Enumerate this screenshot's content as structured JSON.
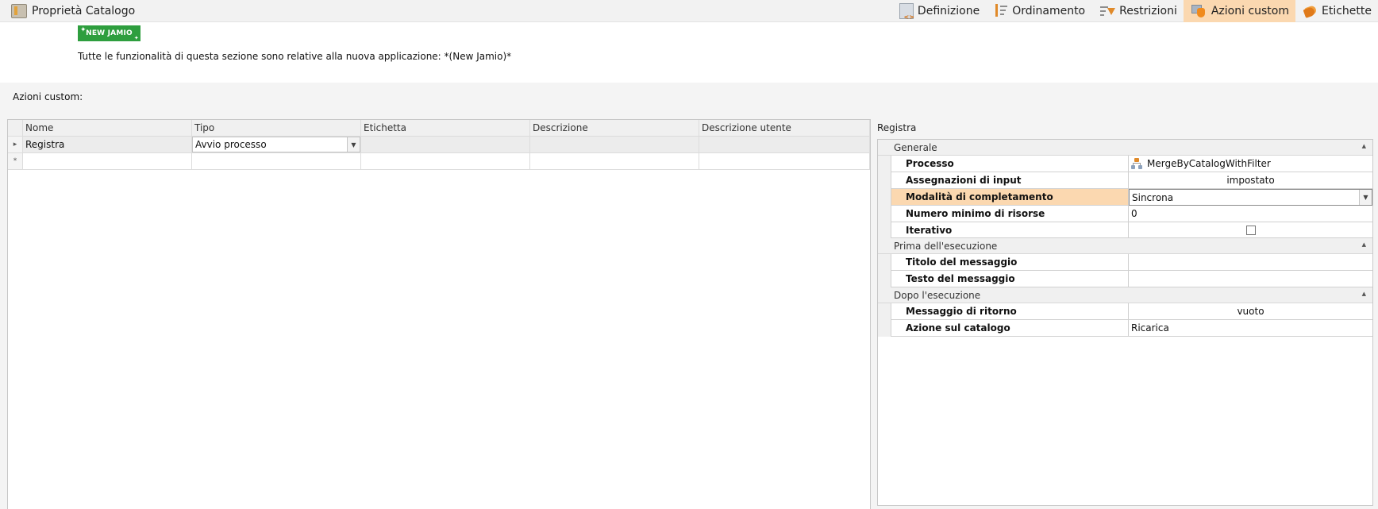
{
  "window": {
    "title": "Proprietà Catalogo"
  },
  "tabs": [
    {
      "label": "Definizione",
      "icon": "definition-icon",
      "active": false
    },
    {
      "label": "Ordinamento",
      "icon": "sort-icon",
      "active": false
    },
    {
      "label": "Restrizioni",
      "icon": "filter-icon",
      "active": false
    },
    {
      "label": "Azioni custom",
      "icon": "custom-action-icon",
      "active": true
    },
    {
      "label": "Etichette",
      "icon": "tag-icon",
      "active": false
    }
  ],
  "info": {
    "badge": "NEW JAMIO",
    "text": "Tutte le funzionalità di questa sezione sono relative alla nuova applicazione: *(New Jamio)*"
  },
  "section": {
    "label": "Azioni custom:"
  },
  "grid": {
    "columns": [
      "Nome",
      "Tipo",
      "Etichetta",
      "Descrizione",
      "Descrizione utente"
    ],
    "rows": [
      {
        "marker": "▸",
        "cells": [
          "Registra",
          "Avvio processo",
          "",
          "",
          ""
        ]
      }
    ],
    "new_row_marker": "*"
  },
  "properties": {
    "title": "Registra",
    "categories": [
      {
        "name": "Generale",
        "rows": [
          {
            "label": "Processo",
            "value": "MergeByCatalogWithFilter"
          },
          {
            "label": "Assegnazioni di input",
            "value": "impostato"
          },
          {
            "label": "Modalità di completamento",
            "value": "Sincrona"
          },
          {
            "label": "Numero minimo di risorse",
            "value": "0"
          },
          {
            "label": "Iterativo",
            "value": ""
          }
        ]
      },
      {
        "name": "Prima dell'esecuzione",
        "rows": [
          {
            "label": "Titolo del messaggio",
            "value": ""
          },
          {
            "label": "Testo del messaggio",
            "value": ""
          }
        ]
      },
      {
        "name": "Dopo l'esecuzione",
        "rows": [
          {
            "label": "Messaggio di ritorno",
            "value": "vuoto"
          },
          {
            "label": "Azione sul catalogo",
            "value": "Ricarica"
          }
        ]
      }
    ]
  },
  "colors": {
    "accent": "#fbd8b0",
    "badge": "#2e9e3e"
  }
}
